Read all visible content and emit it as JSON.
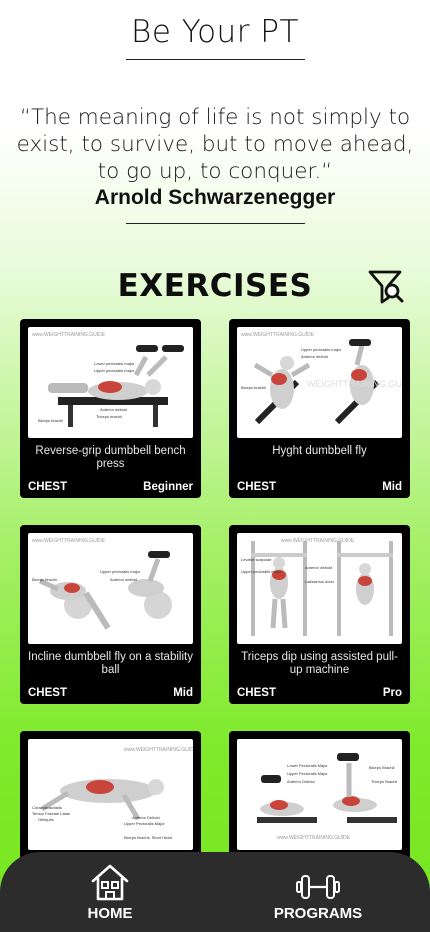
{
  "header": {
    "title": "Be Your PT",
    "quote": "“The meaning of life is not simply to exist, to survive, but to move ahead, to go up, to conquer.“",
    "author": "Arnold Schwarzenegger"
  },
  "section": {
    "title": "EXERCISES",
    "filter_icon": "filter-search-icon"
  },
  "exercises": [
    {
      "name": "Reverse-grip dumbbell bench press",
      "muscle": "CHEST",
      "level": "Beginner"
    },
    {
      "name": "Hyght dumbbell fly",
      "muscle": "CHEST",
      "level": "Mid"
    },
    {
      "name": "Incline dumbbell fly on a stability ball",
      "muscle": "CHEST",
      "level": "Mid"
    },
    {
      "name": "Triceps dip using assisted pull-up machine",
      "muscle": "CHEST",
      "level": "Pro"
    },
    {
      "name": "",
      "muscle": "",
      "level": ""
    },
    {
      "name": "",
      "muscle": "",
      "level": ""
    }
  ],
  "nav": {
    "items": [
      {
        "label": "HOME",
        "icon": "home-icon"
      },
      {
        "label": "PROGRAMS",
        "icon": "dumbbell-icon"
      }
    ]
  },
  "colors": {
    "gradient_top": "#ffffff",
    "gradient_bottom": "#76e61f",
    "card_bg": "#000000",
    "nav_bg": "#2c2c2c"
  }
}
